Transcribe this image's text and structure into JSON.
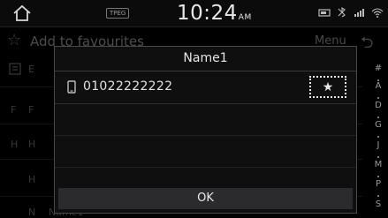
{
  "status_bar": {
    "tpeg": "TPEG",
    "time": "10:24",
    "ampm": "AM"
  },
  "toolbar": {
    "add_favourites": "Add to favourites",
    "menu": "Menu"
  },
  "background_list": {
    "letters": [
      "F",
      "H",
      "N"
    ],
    "partial_entries": [
      "F",
      "H",
      "Name1"
    ]
  },
  "index_bar": [
    "#",
    "A",
    "D",
    "G",
    "J",
    "M",
    "P",
    "S"
  ],
  "popup": {
    "title": "Name1",
    "phone_number": "01022222222",
    "ok_label": "OK"
  },
  "colors": {
    "background": "#000000",
    "popup_bg": "#0f0f10",
    "ok_button": "#2b2b2d",
    "text": "#e6e6e6"
  }
}
